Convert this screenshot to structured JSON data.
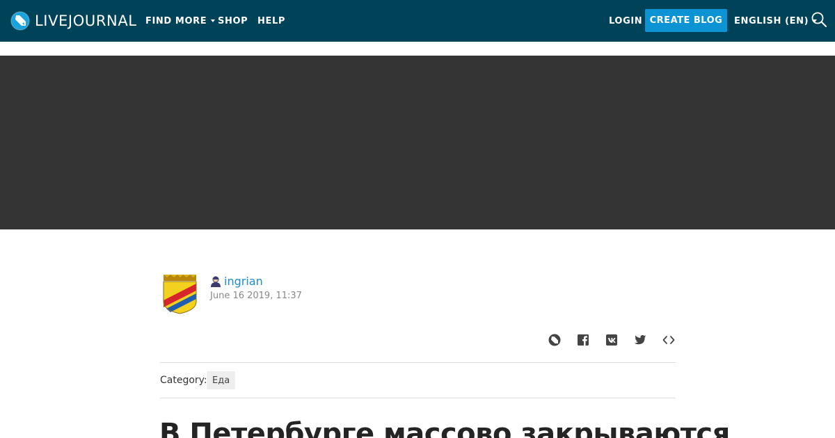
{
  "header": {
    "logo_text": "LIVEJOURNAL",
    "nav": {
      "find_more": "FIND MORE",
      "shop": "SHOP",
      "help": "HELP",
      "login": "LOGIN",
      "create_blog": "CREATE BLOG",
      "language": "ENGLISH (EN)"
    },
    "search_icon": "search-icon"
  },
  "post": {
    "author": "ingrian",
    "date": "June 16 2019, 11:37",
    "category_label": "Category:",
    "category": "Еда",
    "title": "В Петербурге массово закрываются",
    "share_icons": [
      "livejournal-icon",
      "facebook-icon",
      "vk-icon",
      "twitter-icon",
      "embed-icon"
    ]
  },
  "colors": {
    "topbar": "#004359",
    "create_button": "#0b93d3",
    "banner": "#343434",
    "link": "#1b8ccc"
  }
}
